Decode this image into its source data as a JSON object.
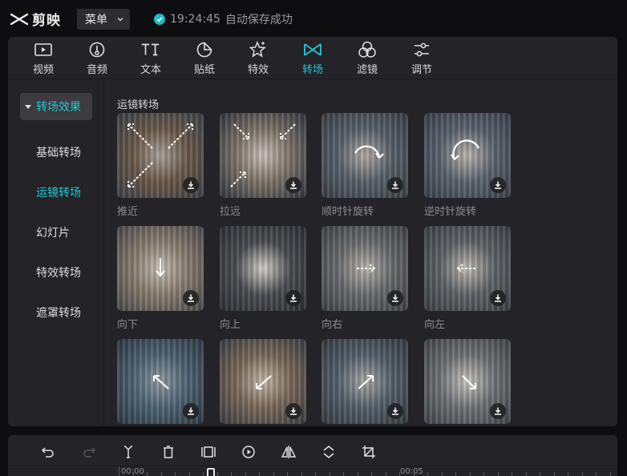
{
  "app": {
    "name": "剪映"
  },
  "menu": {
    "label": "菜单"
  },
  "save_status": {
    "time": "19:24:45",
    "text": "自动保存成功"
  },
  "tabs": [
    {
      "label": "视频",
      "icon": "video-icon"
    },
    {
      "label": "音频",
      "icon": "audio-icon"
    },
    {
      "label": "文本",
      "icon": "text-icon"
    },
    {
      "label": "贴纸",
      "icon": "sticker-icon"
    },
    {
      "label": "特效",
      "icon": "effects-icon"
    },
    {
      "label": "转场",
      "icon": "transition-icon",
      "active": true
    },
    {
      "label": "滤镜",
      "icon": "filter-icon"
    },
    {
      "label": "调节",
      "icon": "adjust-icon"
    }
  ],
  "sidebar": {
    "header": "转场效果",
    "items": [
      {
        "label": "基础转场"
      },
      {
        "label": "运镜转场",
        "active": true
      },
      {
        "label": "幻灯片"
      },
      {
        "label": "特效转场"
      },
      {
        "label": "遮罩转场"
      }
    ]
  },
  "content": {
    "section_title": "运镜转场",
    "items": [
      {
        "label": "推近",
        "arrow": "diagonal-out"
      },
      {
        "label": "拉远",
        "arrow": "diagonal-in"
      },
      {
        "label": "顺时针旋转",
        "arrow": "clockwise"
      },
      {
        "label": "逆时针旋转",
        "arrow": "counterclockwise"
      },
      {
        "label": "向下",
        "arrow": "down"
      },
      {
        "label": "向上",
        "arrow": "none"
      },
      {
        "label": "向右",
        "arrow": "right"
      },
      {
        "label": "向左",
        "arrow": "left"
      },
      {
        "label": "",
        "arrow": "up-left"
      },
      {
        "label": "",
        "arrow": "down-left"
      },
      {
        "label": "",
        "arrow": "up-right"
      },
      {
        "label": "",
        "arrow": "down-right"
      }
    ]
  },
  "toolbar": {
    "tools": [
      "undo-icon",
      "redo-icon",
      "split-icon",
      "delete-icon",
      "freeze-icon",
      "play-icon",
      "mirror-icon",
      "rotate-icon",
      "crop-icon"
    ]
  },
  "timeline": {
    "start_label": "00:00",
    "mark_label": "00:05"
  },
  "colors": {
    "accent": "#22c7d7",
    "panel": "#242428",
    "background": "#0e0e10"
  }
}
